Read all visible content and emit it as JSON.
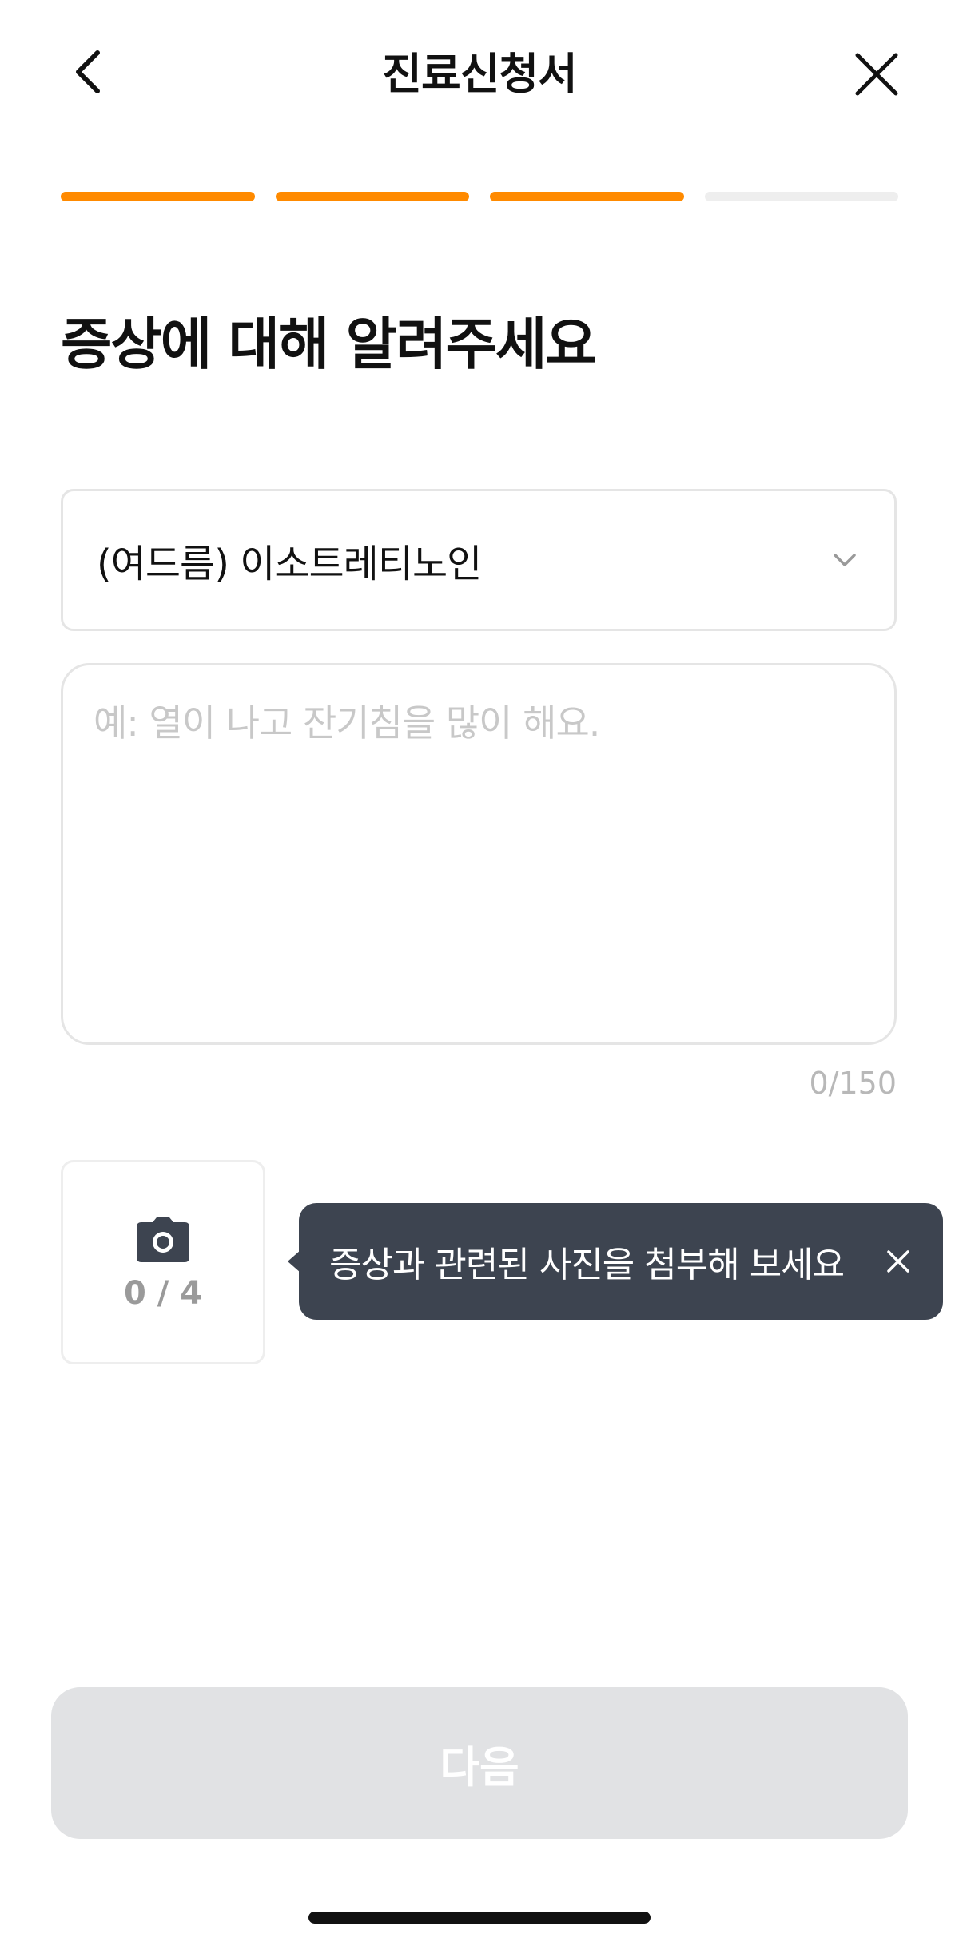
{
  "header": {
    "title": "진료신청서",
    "back_icon": "chevron-left-icon",
    "close_icon": "close-icon"
  },
  "progress": {
    "total_steps": 4,
    "completed_steps": 3,
    "active_color": "#ff8a00",
    "inactive_color": "#eeeeee"
  },
  "heading": "증상에 대해 알려주세요",
  "symptom_select": {
    "selected_value": "(여드름) 이소트레티노인",
    "icon": "chevron-down-icon"
  },
  "symptom_text": {
    "value": "",
    "placeholder": "예: 열이 나고 잔기침을 많이 해요.",
    "counter": "0/150"
  },
  "photo": {
    "icon": "camera-icon",
    "count": "0 / 4"
  },
  "tooltip": {
    "text": "증상과 관련된 사진을 첨부해 보세요",
    "close_icon": "close-icon"
  },
  "next_button": {
    "label": "다음"
  },
  "colors": {
    "accent": "#ff8a00",
    "tooltip_bg": "#3d4450",
    "disabled_button_bg": "#e1e2e4"
  }
}
